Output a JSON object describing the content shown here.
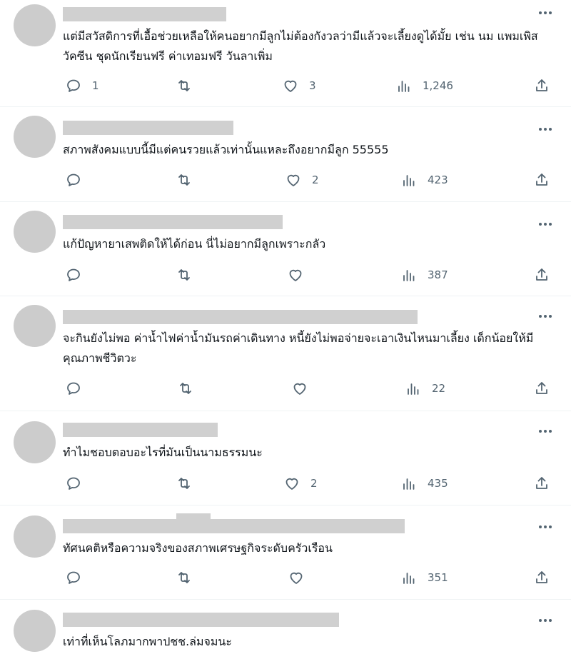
{
  "colors": {
    "text": "#0f1419",
    "icon": "#536471",
    "avatar": "#cccccc",
    "name_placeholder": "#d0d0d0",
    "divider": "#eff3f4"
  },
  "icons": {
    "reply": "reply-icon",
    "retweet": "retweet-icon",
    "like": "heart-icon",
    "views": "views-icon",
    "share": "share-icon",
    "more": "more-icon"
  },
  "tweets": [
    {
      "text": "แต่มีสวัสดิการที่เอื้อช่วยเหลือให้คนอยากมีลูกไม่ต้องกังวลว่ามีแล้วจะเลี้ยงดูได้มั้ย เช่น นม แพมเพิส วัคซีน ชุดนักเรียนฟรี ค่าเทอมฟรี วันลาเพิ่ม",
      "replies": "1",
      "retweets": "",
      "likes": "3",
      "views": "1,246"
    },
    {
      "text": "สภาพสังคมแบบนี้มีแต่คนรวยแล้วเท่านั้นแหละถึงอยากมีลูก 55555",
      "replies": "",
      "retweets": "",
      "likes": "2",
      "views": "423"
    },
    {
      "text": "แก้ปัญหายาเสพติดให้ได้ก่อน นี่ไม่อยากมีลูกเพราะกลัว",
      "replies": "",
      "retweets": "",
      "likes": "",
      "views": "387"
    },
    {
      "text": "จะกินยังไม่พอ ค่าน้ำไฟค่าน้ำมันรถค่าเดินทาง หนี้ยังไม่พอจ่ายจะเอาเงินไหนมาเลี้ยง เด็กน้อยให้มีคุณภาพชีวิตวะ",
      "replies": "",
      "retweets": "",
      "likes": "",
      "views": "22"
    },
    {
      "text": "ทำไมชอบตอบอะไรที่มันเป็นนามธรรมนะ",
      "replies": "",
      "retweets": "",
      "likes": "2",
      "views": "435"
    },
    {
      "text": "ทัศนคติหรือความจริงของสภาพเศรษฐกิจระดับครัวเรือน",
      "replies": "",
      "retweets": "",
      "likes": "",
      "views": "351"
    },
    {
      "text": "เท่าที่เห็นโลภมากพาปชช.ล่มจมนะ",
      "replies": "",
      "retweets": "",
      "likes": "",
      "views": ""
    }
  ]
}
